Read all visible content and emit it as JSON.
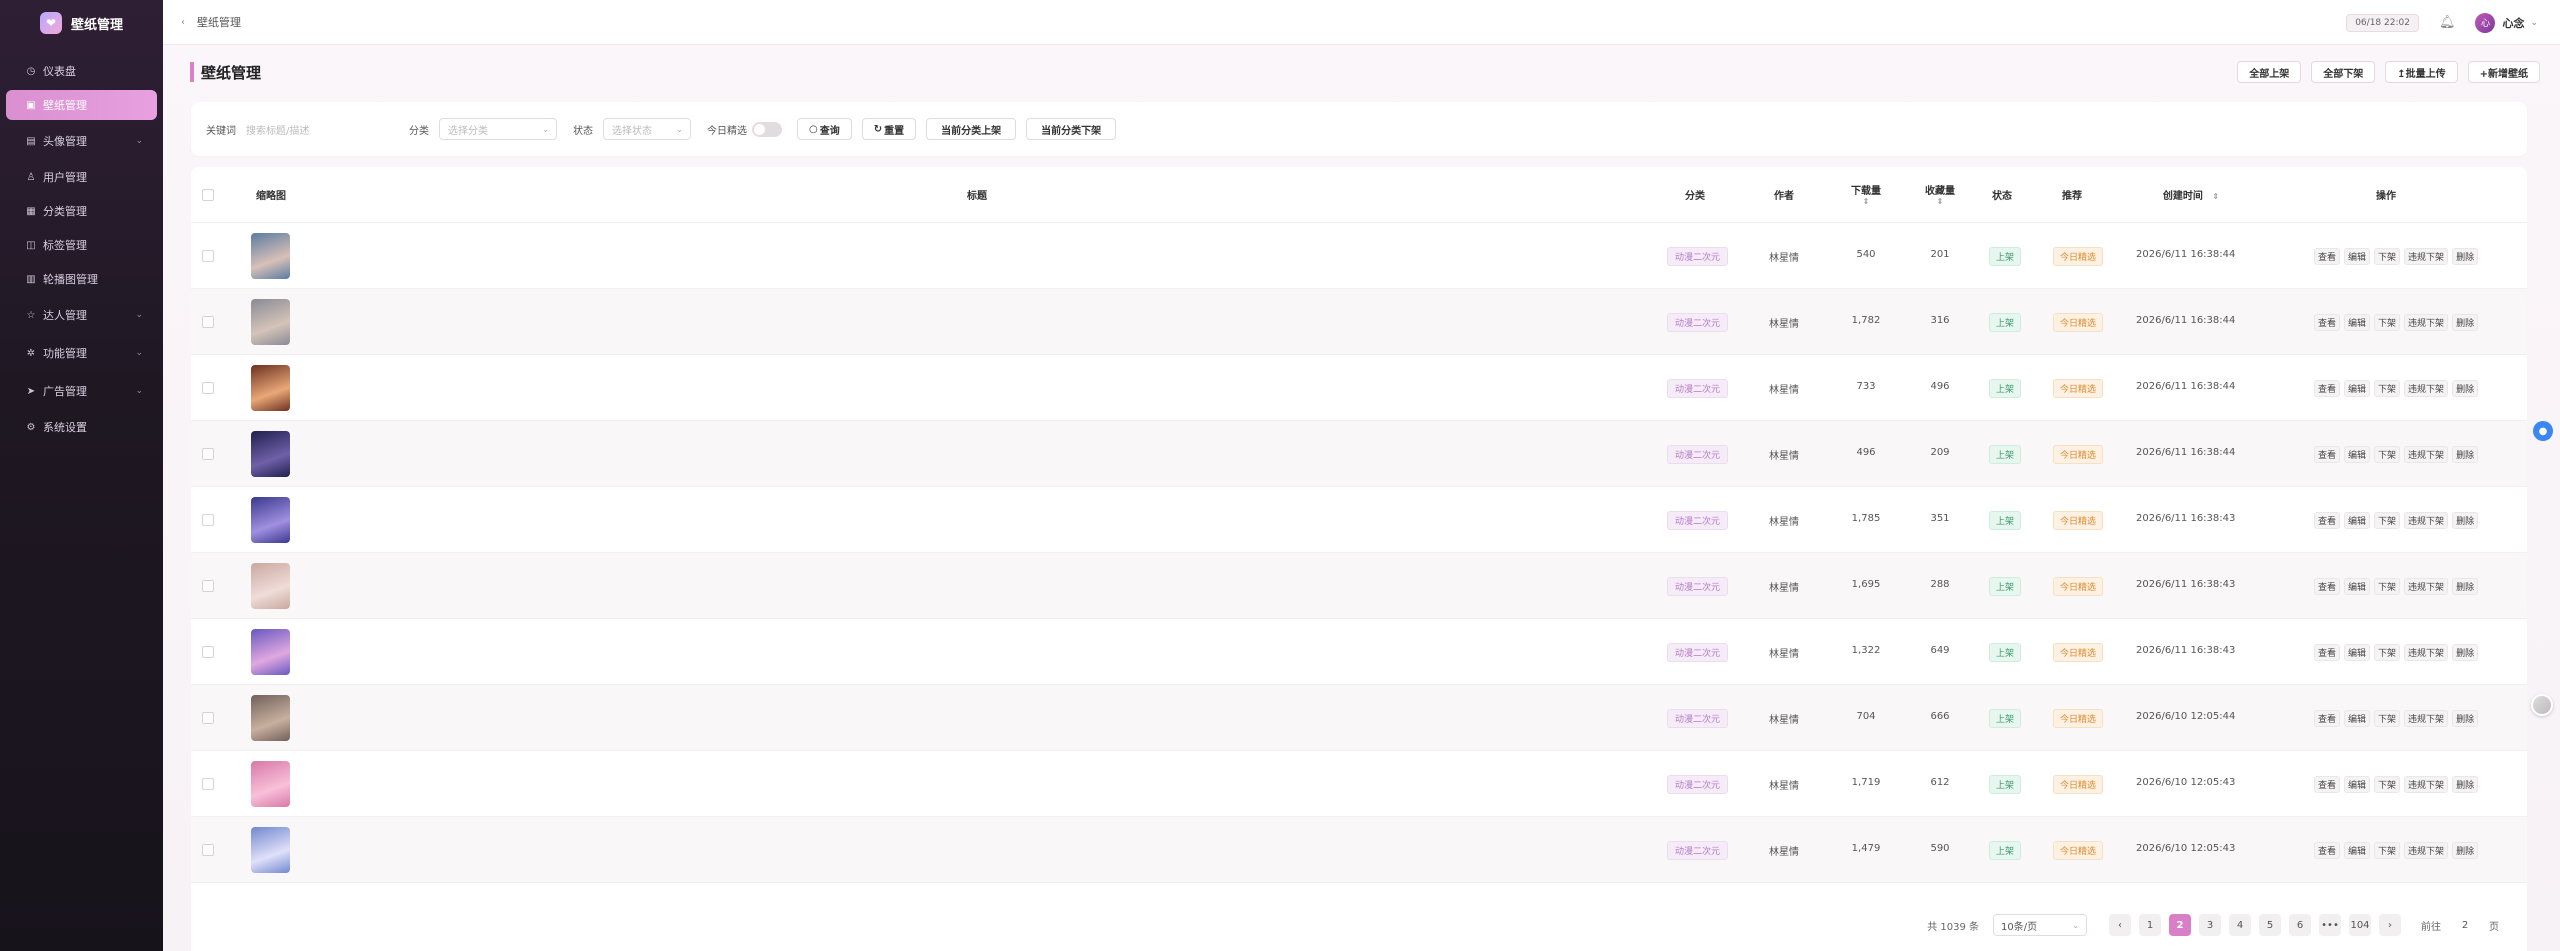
{
  "app": {
    "title": "壁纸管理"
  },
  "sidebar": {
    "items": [
      {
        "label": "仪表盘",
        "icon": "dashboard-icon"
      },
      {
        "label": "壁纸管理",
        "icon": "image-icon",
        "active": true
      },
      {
        "label": "头像管理",
        "icon": "avatar-icon",
        "expandable": true
      },
      {
        "label": "用户管理",
        "icon": "user-icon"
      },
      {
        "label": "分类管理",
        "icon": "grid-icon"
      },
      {
        "label": "标签管理",
        "icon": "tag-icon"
      },
      {
        "label": "轮播图管理",
        "icon": "carousel-icon"
      },
      {
        "label": "达人管理",
        "icon": "star-icon",
        "expandable": true
      },
      {
        "label": "功能管理",
        "icon": "gear-icon",
        "expandable": true
      },
      {
        "label": "广告管理",
        "icon": "send-icon",
        "expandable": true
      },
      {
        "label": "系统设置",
        "icon": "settings-icon"
      }
    ]
  },
  "topbar": {
    "breadcrumb": "壁纸管理",
    "time": "06/18 22:02",
    "user": "心念",
    "avatar_text": "心"
  },
  "page": {
    "title": "壁纸管理"
  },
  "actions": {
    "all_up": "全部上架",
    "all_down": "全部下架",
    "batch_upload": "↥批量上传",
    "add": "+新增壁纸"
  },
  "filters": {
    "keyword_label": "关键词",
    "keyword_placeholder": "搜索标题/描述",
    "category_label": "分类",
    "category_placeholder": "选择分类",
    "status_label": "状态",
    "status_placeholder": "选择状态",
    "daily_label": "今日精选",
    "daily_on": false,
    "query": "查询",
    "reset": "重置",
    "cat_up": "当前分类上架",
    "cat_down": "当前分类下架"
  },
  "table": {
    "headers": {
      "thumb": "缩略图",
      "title": "标题",
      "category": "分类",
      "author": "作者",
      "downloads": "下载量",
      "favorites": "收藏量",
      "status": "状态",
      "recommend": "推荐",
      "created": "创建时间",
      "ops": "操作"
    },
    "op_labels": [
      "查看",
      "编辑",
      "下架",
      "违规下架",
      "删除"
    ],
    "rows": [
      {
        "title": "",
        "category": "动漫二次元",
        "author": "林星情",
        "downloads": "540",
        "favorites": "201",
        "status": "上架",
        "recommend": "今日精选",
        "created": "2026/6/11 16:38:44",
        "thumb_colors": [
          "#5a7ca0",
          "#d8c0b8"
        ]
      },
      {
        "title": "",
        "category": "动漫二次元",
        "author": "林星情",
        "downloads": "1,782",
        "favorites": "316",
        "status": "上架",
        "recommend": "今日精选",
        "created": "2026/6/11 16:38:44",
        "thumb_colors": [
          "#8a8a96",
          "#d4c4b8"
        ]
      },
      {
        "title": "",
        "category": "动漫二次元",
        "author": "林星情",
        "downloads": "733",
        "favorites": "496",
        "status": "上架",
        "recommend": "今日精选",
        "created": "2026/6/11 16:38:44",
        "thumb_colors": [
          "#6b3020",
          "#e8a878"
        ]
      },
      {
        "title": "",
        "category": "动漫二次元",
        "author": "林星情",
        "downloads": "496",
        "favorites": "209",
        "status": "上架",
        "recommend": "今日精选",
        "created": "2026/6/11 16:38:44",
        "thumb_colors": [
          "#1f2050",
          "#7060a8"
        ]
      },
      {
        "title": "",
        "category": "动漫二次元",
        "author": "林星情",
        "downloads": "1,785",
        "favorites": "351",
        "status": "上架",
        "recommend": "今日精选",
        "created": "2026/6/11 16:38:43",
        "thumb_colors": [
          "#3a3890",
          "#a090e0"
        ]
      },
      {
        "title": "",
        "category": "动漫二次元",
        "author": "林星情",
        "downloads": "1,695",
        "favorites": "288",
        "status": "上架",
        "recommend": "今日精选",
        "created": "2026/6/11 16:38:43",
        "thumb_colors": [
          "#c8a8a0",
          "#f0dcd8"
        ]
      },
      {
        "title": "",
        "category": "动漫二次元",
        "author": "林星情",
        "downloads": "1,322",
        "favorites": "649",
        "status": "上架",
        "recommend": "今日精选",
        "created": "2026/6/11 16:38:43",
        "thumb_colors": [
          "#6858c0",
          "#e0a8e0"
        ]
      },
      {
        "title": "",
        "category": "动漫二次元",
        "author": "林星情",
        "downloads": "704",
        "favorites": "666",
        "status": "上架",
        "recommend": "今日精选",
        "created": "2026/6/10 12:05:44",
        "thumb_colors": [
          "#706058",
          "#c8b0a0"
        ]
      },
      {
        "title": "",
        "category": "动漫二次元",
        "author": "林星情",
        "downloads": "1,719",
        "favorites": "612",
        "status": "上架",
        "recommend": "今日精选",
        "created": "2026/6/10 12:05:43",
        "thumb_colors": [
          "#d878a8",
          "#f8c0d8"
        ]
      },
      {
        "title": "",
        "category": "动漫二次元",
        "author": "林星情",
        "downloads": "1,479",
        "favorites": "590",
        "status": "上架",
        "recommend": "今日精选",
        "created": "2026/6/10 12:05:43",
        "thumb_colors": [
          "#7088d0",
          "#e0e0f8"
        ]
      }
    ]
  },
  "pagination": {
    "total": "共 1039 条",
    "page_size": "10条/页",
    "prev": "‹",
    "next": "›",
    "pages": [
      "1",
      "2",
      "3",
      "4",
      "5",
      "6",
      "•••",
      "104"
    ],
    "current": "2",
    "goto_label": "前往",
    "goto_value": "2",
    "page_suffix": "页"
  },
  "colors": {
    "accent": "#d97fc7",
    "sidebar_bg": "#1f1823"
  }
}
